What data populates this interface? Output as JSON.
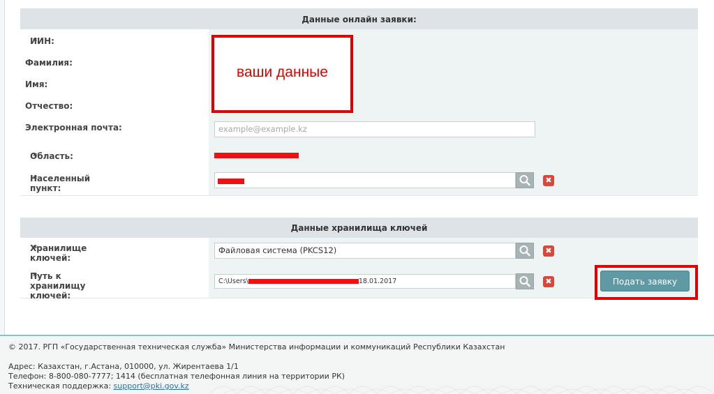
{
  "online_section": {
    "title": "Данные онлайн заявки:",
    "fields": [
      {
        "label": "ИИН:",
        "required": "*"
      },
      {
        "label": "Фамилия:"
      },
      {
        "label": "Имя:"
      },
      {
        "label": "Отчество:"
      },
      {
        "label": "Электронная почта:",
        "placeholder": "example@example.kz"
      },
      {
        "label": "Область:",
        "required": "*"
      },
      {
        "label": "Населенный пункт:",
        "required": "*"
      }
    ],
    "callout_text": "ваши данные"
  },
  "keystore_section": {
    "title": "Данные хранилища ключей",
    "storage": {
      "label": "Хранилище ключей:",
      "required": "*",
      "value": "Файловая система (PKCS12)"
    },
    "path": {
      "label": "Путь к хранилищу ключей:",
      "required": "*",
      "value_prefix": "C:\\Users\\",
      "value_suffix": "18.01.2017"
    },
    "submit_label": "Подать заявку",
    "clear_glyph": "✖"
  },
  "footer": {
    "copyright": "© 2017. РГП «Государственная техническая служба» Министерства информации и коммуникаций Республики Казахстан",
    "address": "Адрес: Казахстан, г.Астана, 010000, ул. Жирентаева 1/1",
    "phone": "Телефон: 8-800-080-7777; 1414 (бесплатная телефонная линия на территории РК)",
    "support_label": "Техническая поддержка: ",
    "support_email": "support@pki.gov.kz"
  },
  "colors": {
    "accent": "#5f9aa4",
    "required": "#e0262b",
    "redaction": "#ee1111",
    "callout": "#e00000"
  }
}
